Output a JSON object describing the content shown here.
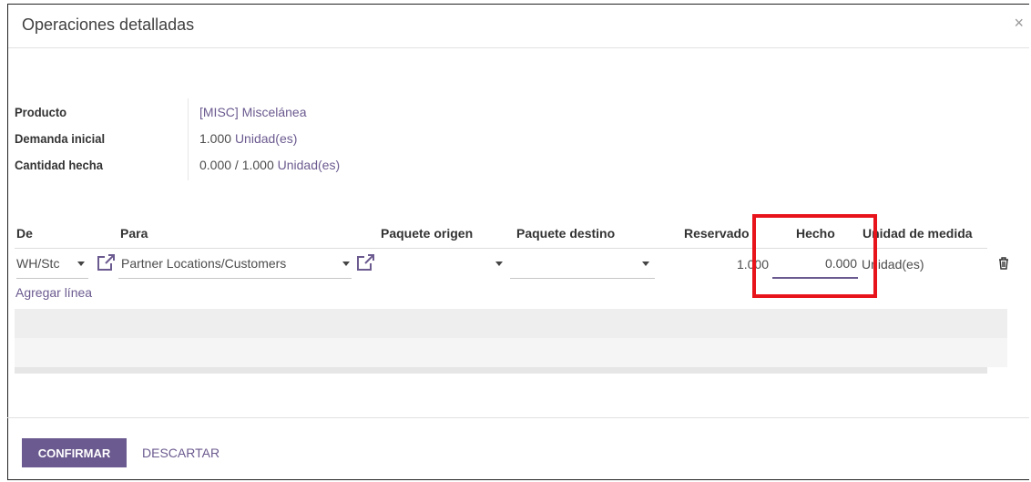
{
  "dialog": {
    "title": "Operaciones detalladas",
    "close_glyph": "×"
  },
  "info": {
    "product_label": "Producto",
    "product_value": "[MISC] Miscelánea",
    "demand_label": "Demanda inicial",
    "demand_qty": "1.000",
    "demand_uom": "Unidad(es)",
    "done_label": "Cantidad hecha",
    "done_qty": "0.000 / 1.000",
    "done_uom": "Unidad(es)"
  },
  "table": {
    "headers": {
      "from": "De",
      "to": "Para",
      "source_package": "Paquete origen",
      "dest_package": "Paquete destino",
      "reserved": "Reservado",
      "done": "Hecho",
      "uom": "Unidad de medida"
    },
    "row": {
      "from": "WH/Stc",
      "to": "Partner Locations/Customers",
      "source_package": "",
      "dest_package": "",
      "reserved": "1.000",
      "done": "0.000",
      "uom": "Unidad(es)"
    },
    "add_line": "Agregar línea"
  },
  "footer": {
    "confirm": "CONFIRMAR",
    "discard": "DESCARTAR"
  },
  "colors": {
    "accent": "#6b5a8f",
    "highlight": "#e8141b"
  },
  "icons": [
    "close-icon",
    "external-link-icon",
    "caret-down-icon",
    "trash-icon"
  ]
}
